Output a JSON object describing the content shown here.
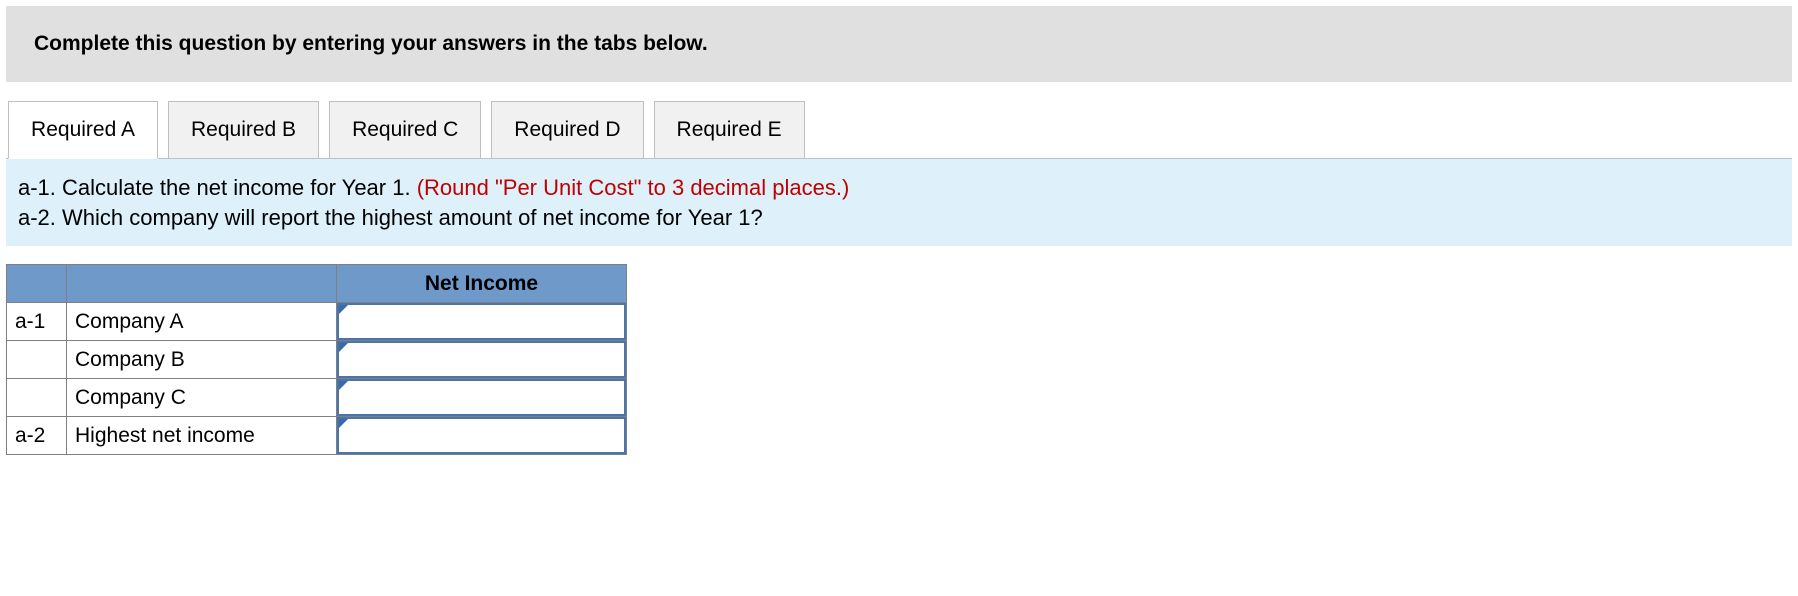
{
  "instruction": "Complete this question by entering your answers in the tabs below.",
  "tabs": {
    "t0": "Required A",
    "t1": "Required B",
    "t2": "Required C",
    "t3": "Required D",
    "t4": "Required E"
  },
  "prompt": {
    "line1_prefix": "a-1. Calculate the net income for Year 1. ",
    "line1_red": "(Round \"Per Unit Cost\" to 3 decimal places.)",
    "line2": "a-2. Which company will report the highest amount of net income for Year 1?"
  },
  "table": {
    "header_income": "Net Income",
    "rows": [
      {
        "part": "a-1",
        "label": "Company A",
        "value": ""
      },
      {
        "part": "",
        "label": "Company B",
        "value": ""
      },
      {
        "part": "",
        "label": "Company C",
        "value": ""
      },
      {
        "part": "a-2",
        "label": "Highest net income",
        "value": ""
      }
    ]
  }
}
